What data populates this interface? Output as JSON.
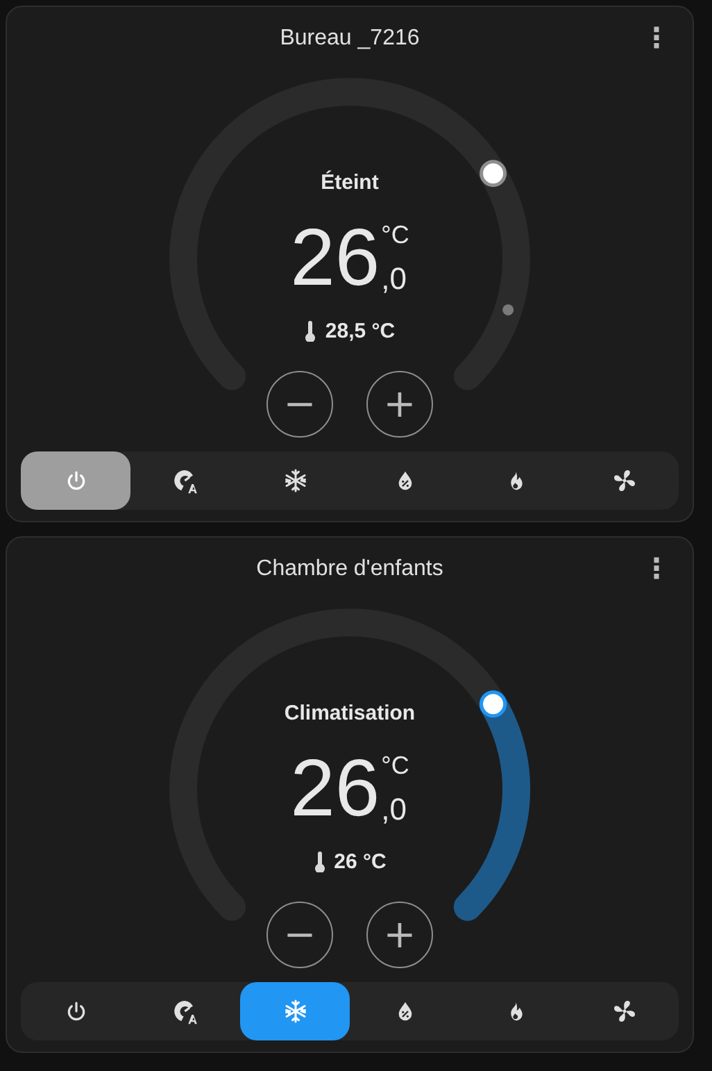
{
  "cards": [
    {
      "title": "Bureau _7216",
      "menu": "⋮",
      "state": "Éteint",
      "target": {
        "integer": "26",
        "unit": "°C",
        "decimal": ",0"
      },
      "current_marker": true,
      "current": "28,5 °C",
      "cooling": false,
      "minus": "−",
      "plus": "+",
      "modes": [
        {
          "kind": "off",
          "selected": true
        },
        {
          "kind": "auto",
          "selected": false
        },
        {
          "kind": "cool",
          "selected": false
        },
        {
          "kind": "dry",
          "selected": false
        },
        {
          "kind": "heat",
          "selected": false
        },
        {
          "kind": "fan",
          "selected": false
        }
      ]
    },
    {
      "title": "Chambre d'enfants",
      "menu": "⋮",
      "state": "Climatisation",
      "target": {
        "integer": "26",
        "unit": "°C",
        "decimal": ",0"
      },
      "current": "26 °C",
      "cooling": true,
      "minus": "−",
      "plus": "+",
      "modes": [
        {
          "kind": "off",
          "selected": false
        },
        {
          "kind": "auto",
          "selected": false
        },
        {
          "kind": "cool",
          "selected": true
        },
        {
          "kind": "dry",
          "selected": false
        },
        {
          "kind": "heat",
          "selected": false
        },
        {
          "kind": "fan",
          "selected": false
        }
      ]
    }
  ]
}
